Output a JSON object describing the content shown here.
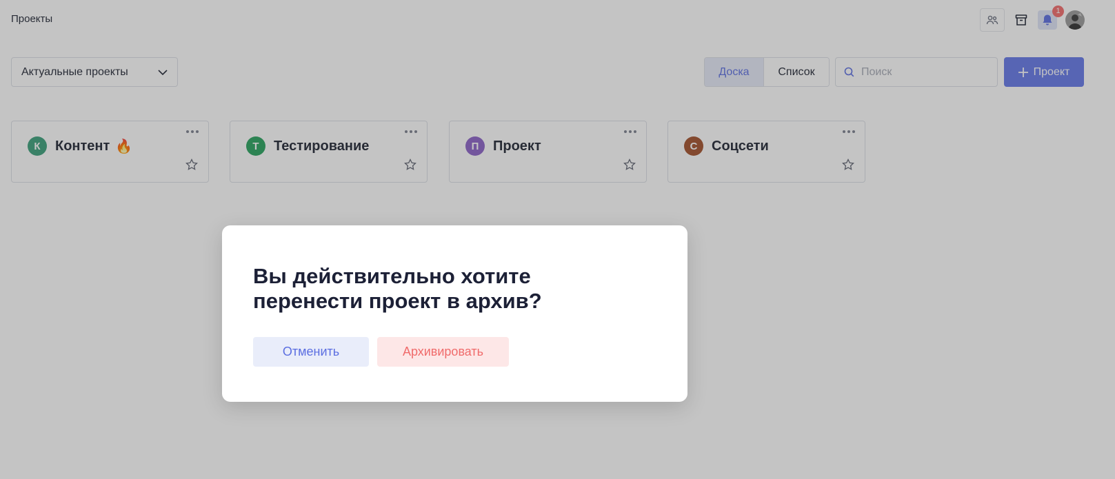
{
  "header": {
    "title": "Проекты",
    "notifications_count": "1",
    "icons": [
      "team-icon",
      "archive-icon",
      "bell-icon",
      "user-avatar"
    ]
  },
  "toolbar": {
    "project_filter": "Актуальные проекты",
    "view_board": "Доска",
    "view_list": "Список",
    "search_placeholder": "Поиск",
    "add_project": "Проект"
  },
  "projects": [
    {
      "letter": "К",
      "name": "Контент",
      "color": "#3aa07a",
      "emoji": "🔥"
    },
    {
      "letter": "Т",
      "name": "Тестирование",
      "color": "#27a35d",
      "emoji": ""
    },
    {
      "letter": "П",
      "name": "Проект",
      "color": "#8c62c8",
      "emoji": ""
    },
    {
      "letter": "С",
      "name": "Соцсети",
      "color": "#a2502a",
      "emoji": ""
    }
  ],
  "modal": {
    "title": "Вы действительно хотите перенести проект в архив?",
    "cancel": "Отменить",
    "confirm": "Архивировать"
  },
  "colors": {
    "accent": "#6377e8",
    "danger": "#f06b6b"
  }
}
